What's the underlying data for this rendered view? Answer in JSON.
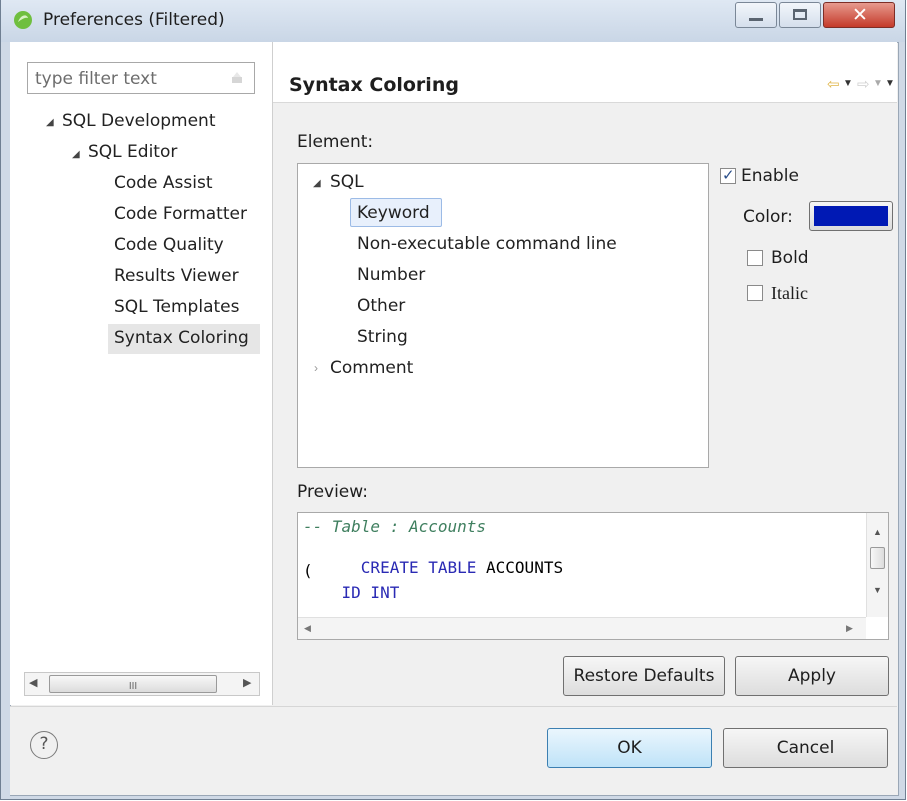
{
  "window": {
    "title": "Preferences (Filtered)"
  },
  "filter": {
    "placeholder": "type filter text"
  },
  "nav": {
    "root": "SQL Development",
    "editor": "SQL Editor",
    "items": [
      "Code Assist",
      "Code Formatter",
      "Code Quality",
      "Results Viewer",
      "SQL Templates",
      "Syntax Coloring"
    ],
    "selected": "Syntax Coloring",
    "hscroll_label": "III"
  },
  "page": {
    "title": "Syntax Coloring",
    "element_label": "Element:",
    "preview_label": "Preview:"
  },
  "element_tree": {
    "group": "SQL",
    "children": [
      "Keyword",
      "Non-executable command line",
      "Number",
      "Other",
      "String"
    ],
    "selected": "Keyword",
    "collapsed": "Comment"
  },
  "options": {
    "enable_label": "Enable",
    "enable_checked": true,
    "color_label": "Color:",
    "color_value": "#0019b4",
    "bold_label": "Bold",
    "bold_checked": false,
    "italic_label": "Italic",
    "italic_checked": false
  },
  "preview": {
    "line1": "-- Table : Accounts",
    "line2_kw": "CREATE TABLE",
    "line2_id": " ACCOUNTS",
    "line3": "(",
    "line4": "    ID INT"
  },
  "buttons": {
    "restore_defaults": "Restore Defaults",
    "apply": "Apply",
    "ok": "OK",
    "cancel": "Cancel",
    "help": "?"
  },
  "colors": {
    "keyword": "#2a2ab4",
    "comment": "#3f7f5f",
    "selection": "#dbe7f8",
    "accent": "#3a8ee6"
  }
}
